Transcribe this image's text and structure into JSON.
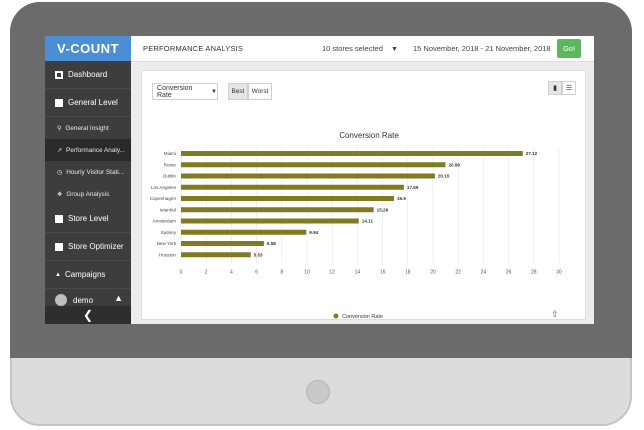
{
  "sidebar": {
    "logo": "V-COUNT",
    "items": [
      {
        "label": "Dashboard"
      },
      {
        "label": "General Level"
      },
      {
        "label": "General Insight"
      },
      {
        "label": "Performance Analy..."
      },
      {
        "label": "Hourly Visitor Stati..."
      },
      {
        "label": "Group Analysis"
      },
      {
        "label": "Store Level"
      },
      {
        "label": "Store Optimizer"
      },
      {
        "label": "Campaigns"
      }
    ],
    "user": "demo",
    "collapse_icon": "chevron-left-icon"
  },
  "header": {
    "title": "PERFORMANCE ANALYSIS",
    "stores": "10 stores selected",
    "date_range": "15 November, 2018 - 21 November, 2018",
    "go": "Go!"
  },
  "controls": {
    "metric": "Conversion Rate",
    "best": "Best",
    "worst": "Worst"
  },
  "colors": {
    "bar": "#807a22",
    "accent": "#4a8fd6",
    "go": "#5cb85c"
  },
  "chart_data": {
    "type": "bar",
    "orientation": "horizontal",
    "title": "Conversion Rate",
    "categories": [
      "Miami",
      "Rome",
      "Dublin",
      "Los Angeles",
      "Copenhagen",
      "Istanbul",
      "Amsterdam",
      "Sydney",
      "New York",
      "Houston"
    ],
    "series": [
      {
        "name": "Conversion Rate",
        "values": [
          27.12,
          20.99,
          20.15,
          17.69,
          16.9,
          15.29,
          14.11,
          9.94,
          6.58,
          5.53
        ]
      }
    ],
    "xlim": [
      0,
      30
    ],
    "ticks": [
      0,
      2,
      4,
      6,
      8,
      10,
      12,
      14,
      16,
      18,
      20,
      22,
      24,
      26,
      28,
      30
    ],
    "grid": true,
    "legend": "bottom-center"
  }
}
